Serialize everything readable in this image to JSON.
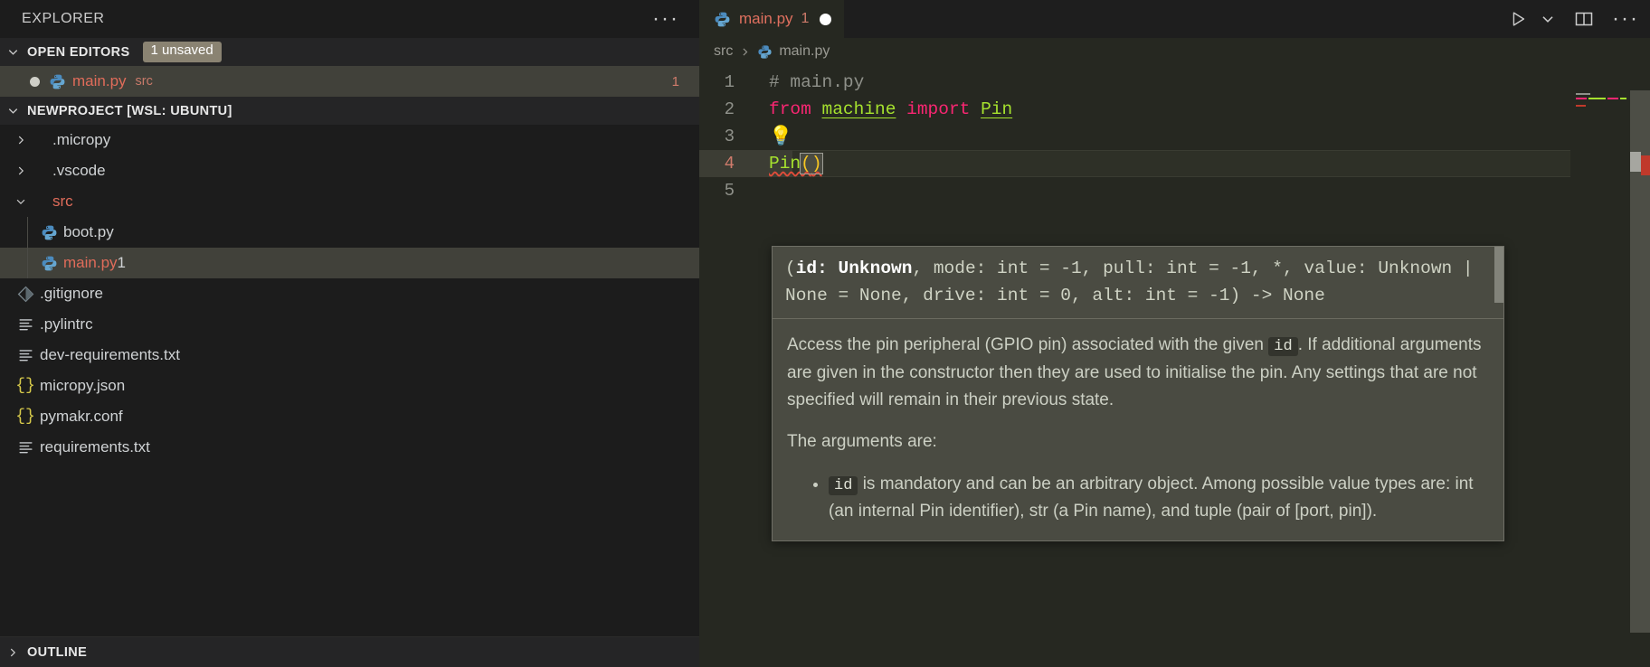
{
  "sidebar": {
    "title": "EXPLORER",
    "more_actions_label": "···",
    "open_editors": {
      "label": "OPEN EDITORS",
      "badge": "1 unsaved",
      "items": [
        {
          "name": "main.py",
          "path": "src",
          "count": "1",
          "icon": "python-icon",
          "dirty": true
        }
      ]
    },
    "project": {
      "label": "NEWPROJECT [WSL: UBUNTU]",
      "items": [
        {
          "label": ".micropy",
          "type": "folder",
          "expanded": false,
          "indent": 1,
          "icon": "chevron-right-icon"
        },
        {
          "label": ".vscode",
          "type": "folder",
          "expanded": false,
          "indent": 1,
          "icon": "chevron-right-icon"
        },
        {
          "label": "src",
          "type": "folder",
          "expanded": true,
          "indent": 1,
          "icon": "chevron-down-icon",
          "error": true,
          "color": "red"
        },
        {
          "label": "boot.py",
          "type": "file",
          "indent": 2,
          "icon": "python-icon"
        },
        {
          "label": "main.py",
          "type": "file",
          "indent": 2,
          "icon": "python-icon",
          "count": "1",
          "selected": true,
          "color": "red"
        },
        {
          "label": ".gitignore",
          "type": "file",
          "indent": 1,
          "icon": "git-icon"
        },
        {
          "label": ".pylintrc",
          "type": "file",
          "indent": 1,
          "icon": "settings-file-icon"
        },
        {
          "label": "dev-requirements.txt",
          "type": "file",
          "indent": 1,
          "icon": "settings-file-icon"
        },
        {
          "label": "micropy.json",
          "type": "file",
          "indent": 1,
          "icon": "json-icon"
        },
        {
          "label": "pymakr.conf",
          "type": "file",
          "indent": 1,
          "icon": "json-icon"
        },
        {
          "label": "requirements.txt",
          "type": "file",
          "indent": 1,
          "icon": "settings-file-icon"
        }
      ]
    },
    "outline": {
      "label": "OUTLINE"
    }
  },
  "editor": {
    "tab": {
      "filename": "main.py",
      "count": "1",
      "icon": "python-icon",
      "dirty": true
    },
    "actions": [
      {
        "name": "run-python-file-button",
        "icon": "play-icon"
      },
      {
        "name": "run-options-chevron",
        "icon": "chevron-down-icon"
      },
      {
        "name": "split-editor-right-button",
        "icon": "split-editor-icon"
      },
      {
        "name": "editor-more-actions-button",
        "icon": "ellipsis-icon"
      }
    ],
    "breadcrumb": [
      "src",
      "main.py"
    ],
    "code": {
      "lines": [
        {
          "num": "1",
          "text": "# main.py"
        },
        {
          "num": "2",
          "text": "from machine import Pin"
        },
        {
          "num": "3",
          "text": ""
        },
        {
          "num": "4",
          "text": "Pin()"
        },
        {
          "num": "5",
          "text": ""
        }
      ],
      "tokens": {
        "comment": "# main.py",
        "kw_from": "from",
        "module": "machine",
        "kw_import": "import",
        "class_pin": "Pin",
        "call": "Pin",
        "open_paren": "(",
        "close_paren": ")"
      },
      "lightbulb": "💡"
    }
  },
  "hover": {
    "signature": {
      "prefix": "(",
      "param_name": "id: Unknown",
      "rest": ", mode: int = -1, pull: int = -1, *, value: Unknown | None = None, drive: int = 0, alt: int = -1) -> None"
    },
    "doc_paragraph_1": "Access the pin peripheral (GPIO pin) associated with the given",
    "doc_chip_1": "id",
    "doc_paragraph_1_cont": ". If additional arguments are given in the constructor then they are used to initialise the pin. Any settings that are not specified will remain in their previous state.",
    "doc_paragraph_2": "The arguments are:",
    "bullets": [
      {
        "chip": "id",
        "text": "is mandatory and can be an arbitrary object. Among possible value types are: int (an internal Pin identifier), str (a Pin name), and tuple (pair of [port, pin])."
      }
    ]
  },
  "colors": {
    "editor_bg": "#262821",
    "sidebar_bg": "#1c1c1c",
    "selection": "#41413a",
    "accent_red": "#e06c5a",
    "keyword_pink": "#f92672",
    "string_green": "#a6e22e",
    "paren_yellow": "#f8c621",
    "error_red": "#c0392b",
    "popup_bg": "#4a4b42"
  }
}
